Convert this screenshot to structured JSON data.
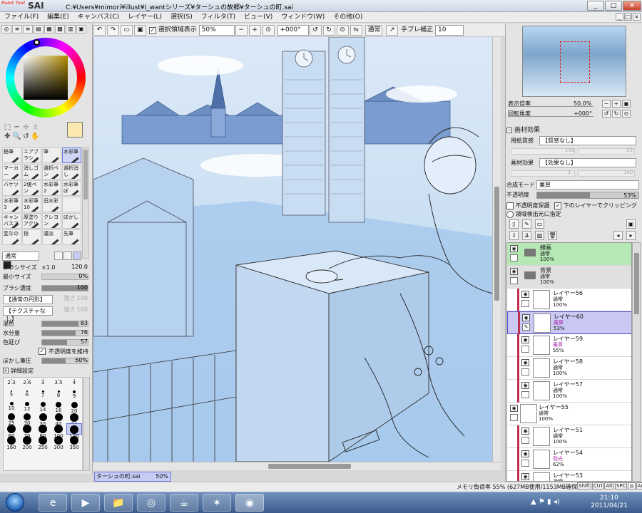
{
  "window": {
    "title": "C:¥Users¥mimori¥illust¥I_wantシリーズ¥ターシュの故郷¥ターシュの町.sai",
    "logo": "SAI",
    "logo_small": "Paint Tool",
    "controls": [
      "_",
      "□",
      "×"
    ]
  },
  "menu": {
    "items": [
      "ファイル(F)",
      "編集(E)",
      "キャンバス(C)",
      "レイヤー(L)",
      "選択(S)",
      "フィルタ(T)",
      "ビュー(V)",
      "ウィンドウ(W)",
      "その他(O)"
    ],
    "right_buttons": [
      "_",
      "□",
      "×"
    ]
  },
  "toolbar": {
    "show_selection_label": "選択領域表示",
    "zoom": "50%",
    "rotation": "+000°",
    "mode_label": "通常",
    "stabilizer_label": "手ブレ補正",
    "stabilizer_value": "10",
    "zoom_minus": "−",
    "zoom_plus": "+"
  },
  "left_panel": {
    "color_tabs": [
      "◎",
      "≡",
      "≡",
      "▤",
      "▦",
      "▩",
      "▥",
      "▣"
    ],
    "selection_tools": [
      "⬚",
      "∽",
      "⊹",
      "☝",
      "✥",
      "🔍",
      "↺",
      "✋"
    ],
    "tools": [
      {
        "label": "鉛筆",
        "selected": false
      },
      {
        "label": "エアブラシ",
        "selected": false
      },
      {
        "label": "筆",
        "selected": false
      },
      {
        "label": "水彩筆",
        "selected": true
      },
      {
        "label": "マーカー",
        "selected": false
      },
      {
        "label": "消しゴム",
        "selected": false
      },
      {
        "label": "選択ペン",
        "selected": false
      },
      {
        "label": "選択消し",
        "selected": false
      },
      {
        "label": "バケツ",
        "selected": false
      },
      {
        "label": "2値ペン",
        "selected": false
      },
      {
        "label": "水彩筆2",
        "selected": false
      },
      {
        "label": "水彩筆ぼ",
        "selected": false
      },
      {
        "label": "水彩筆3",
        "selected": false
      },
      {
        "label": "水彩筆10",
        "selected": false
      },
      {
        "label": "旧水彩",
        "selected": false
      },
      {
        "label": "",
        "selected": false
      },
      {
        "label": "キャンバスアクリル",
        "selected": false
      },
      {
        "label": "厚塗りアクリル",
        "selected": false
      },
      {
        "label": "クレヨン",
        "selected": false
      },
      {
        "label": "ぼかし",
        "selected": false
      },
      {
        "label": "変なの",
        "selected": false
      },
      {
        "label": "指",
        "selected": false
      },
      {
        "label": "濃淡",
        "selected": false
      },
      {
        "label": "先筆",
        "selected": false
      }
    ],
    "blend_mode": "通常",
    "brush_size_label": "ブラシサイズ",
    "brush_size_mult": "×1.0",
    "brush_size_value": "120.0",
    "min_size_label": "最小サイズ",
    "min_size_value": "0%",
    "density_label": "ブラシ濃度",
    "density_value": "100",
    "shape_label": "【通常の円形】",
    "shape_value": "強さ 100",
    "texture_label": "【テクスチャなし】",
    "texture_value": "強さ 100",
    "mix_label": "混色",
    "mix_value": "83",
    "mix_pct": 0.83,
    "water_label": "水分量",
    "water_value": "76",
    "water_pct": 0.76,
    "extend_label": "色延び",
    "extend_value": "57",
    "extend_pct": 0.57,
    "keep_opacity_label": "不透明度を維持",
    "blur_label": "ぼかし筆圧",
    "blur_value": "50%",
    "detail_label": "詳細設定",
    "sizes": [
      {
        "v": "2.3",
        "d": 1
      },
      {
        "v": "2.6",
        "d": 1
      },
      {
        "v": "3",
        "d": 1
      },
      {
        "v": "3.5",
        "d": 1
      },
      {
        "v": "4",
        "d": 1
      },
      {
        "v": "5",
        "d": 2
      },
      {
        "v": "6",
        "d": 2
      },
      {
        "v": "7",
        "d": 3
      },
      {
        "v": "8",
        "d": 3
      },
      {
        "v": "9",
        "d": 4
      },
      {
        "v": "10",
        "d": 5
      },
      {
        "v": "12",
        "d": 6
      },
      {
        "v": "14",
        "d": 7
      },
      {
        "v": "16",
        "d": 8
      },
      {
        "v": "20",
        "d": 9
      },
      {
        "v": "25",
        "d": 10
      },
      {
        "v": "30",
        "d": 10
      },
      {
        "v": "35",
        "d": 11
      },
      {
        "v": "40",
        "d": 11
      },
      {
        "v": "50",
        "d": 12
      },
      {
        "v": "60",
        "d": 12
      },
      {
        "v": "70",
        "d": 12
      },
      {
        "v": "80",
        "d": 12
      },
      {
        "v": "100",
        "d": 12
      },
      {
        "v": "120",
        "d": 12
      },
      {
        "v": "160",
        "d": 12
      },
      {
        "v": "200",
        "d": 12
      },
      {
        "v": "250",
        "d": 12
      },
      {
        "v": "300",
        "d": 12
      },
      {
        "v": "350",
        "d": 12
      }
    ],
    "selected_size": "120"
  },
  "navigator": {
    "zoom_label": "表示倍率",
    "zoom_value": "50.0%",
    "rotate_label": "回転角度",
    "rotate_value": "+000°"
  },
  "effects": {
    "header": "画材効果",
    "paper_label": "用紙質感",
    "paper_value": "【質感なし】",
    "paper_n1": "100",
    "paper_n2": "20",
    "material_label": "画材効果",
    "material_value": "【効果なし】",
    "material_n1": "1",
    "material_n2": "100"
  },
  "layer_props": {
    "mode_label": "合成モード",
    "mode_value": "乗算",
    "opacity_label": "不透明度",
    "opacity_value": "53%",
    "opacity_pct": 0.53,
    "protect_label": "不透明度保護",
    "clip_label": "下のレイヤーでクリッピング",
    "source_label": "領域検出元に指定"
  },
  "layers": [
    {
      "name": "線画",
      "mode": "通常",
      "opacity": "100%",
      "type": "folder-green"
    },
    {
      "name": "背景",
      "mode": "通常",
      "opacity": "100%",
      "type": "folder"
    },
    {
      "name": "レイヤー56",
      "mode": "通常",
      "opacity": "100%",
      "type": "clip"
    },
    {
      "name": "レイヤー60",
      "mode": "乗算",
      "opacity": "53%",
      "type": "clip-selected"
    },
    {
      "name": "レイヤー59",
      "mode": "乗算",
      "opacity": "55%",
      "type": "clip"
    },
    {
      "name": "レイヤー58",
      "mode": "通常",
      "opacity": "100%",
      "type": "clip"
    },
    {
      "name": "レイヤー57",
      "mode": "通常",
      "opacity": "100%",
      "type": "clip"
    },
    {
      "name": "レイヤー55",
      "mode": "通常",
      "opacity": "100%",
      "type": "normal"
    },
    {
      "name": "レイヤー51",
      "mode": "通常",
      "opacity": "100%",
      "type": "clip"
    },
    {
      "name": "レイヤー54",
      "mode": "発光",
      "opacity": "62%",
      "type": "clip"
    },
    {
      "name": "レイヤー53",
      "mode": "通常",
      "opacity": "100%",
      "type": "clip"
    }
  ],
  "document_tab": {
    "name": "ターシュの町.sai",
    "zoom": "50%"
  },
  "status": {
    "memory": "メモリ負荷率 55% (627MB使用/1153MB確保)",
    "keys": [
      "Shift",
      "Ctrl",
      "Alt",
      "SPC",
      "◎",
      "Any"
    ]
  },
  "taskbar": {
    "apps": [
      "e",
      "▶",
      "📁",
      "◎",
      "☕",
      "✶",
      "◉"
    ],
    "tray": "▲ ⚑ ▮ ◂)",
    "time": "21:10",
    "date": "2011/04/21"
  },
  "colors": {
    "fg_color": "#fbe9b0",
    "selected_highlight": "#c9c9f3",
    "folder_green": "#b5e8b5",
    "clip_bar": "#c0304f",
    "canvas_tint": "#cfe3f6"
  }
}
